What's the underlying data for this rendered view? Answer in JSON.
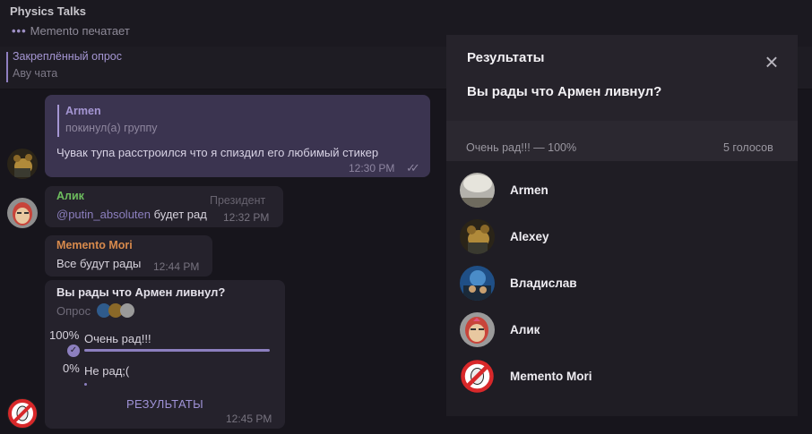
{
  "header": {
    "chat_title": "Physics Talks",
    "typing_text": "Memento печатает"
  },
  "pinned": {
    "title": "Закреплённый опрос",
    "text": "Аву чата"
  },
  "messages": {
    "msg1": {
      "reply_name": "Armen",
      "reply_text": "покинул(а) группу",
      "text": "Чувак тупа расстроился что я спиздил его любимый стикер",
      "time": "12:30 PM"
    },
    "msg2": {
      "name": "Алик",
      "badge": "Президент",
      "mention": "@putin_absoluten",
      "text": " будет рад",
      "time": "12:32 PM"
    },
    "msg3": {
      "name": "Memento Mori",
      "text": "Все будут рады",
      "time": "12:44 PM"
    },
    "poll": {
      "question": "Вы рады что Армен ливнул?",
      "type_label": "Опрос",
      "options": [
        {
          "percent": "100%",
          "label": "Очень рад!!!",
          "share": 1.0
        },
        {
          "percent": "0%",
          "label": "Не рад;(",
          "share": 0.0
        }
      ],
      "results_label": "РЕЗУЛЬТАТЫ",
      "time": "12:45 PM"
    }
  },
  "modal": {
    "title": "Результаты",
    "question": "Вы рады что Армен ливнул?",
    "option_label": "Очень рад!!! — 100%",
    "option_count": "5 голосов",
    "voters": [
      {
        "name": "Armen"
      },
      {
        "name": "Alexey"
      },
      {
        "name": "Владислав"
      },
      {
        "name": "Алик"
      },
      {
        "name": "Memento Mori"
      }
    ]
  },
  "colors": {
    "accent": "#8c7fbf",
    "green_name": "#6dbd5e",
    "orange_name": "#d88a4c"
  }
}
